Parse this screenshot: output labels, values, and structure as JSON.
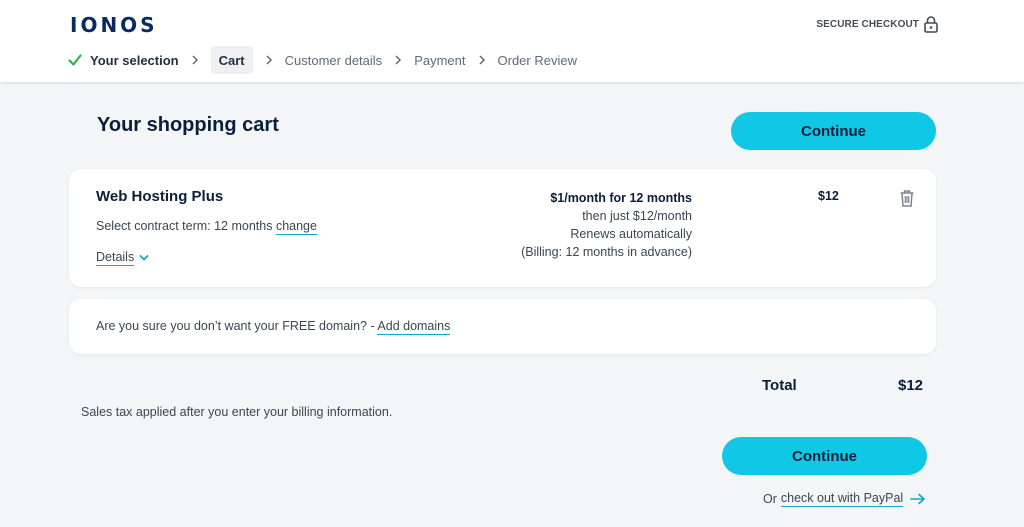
{
  "header": {
    "logo": "IONOS",
    "secure_checkout": "SECURE CHECKOUT",
    "steps": [
      {
        "label": "Your selection",
        "state": "done"
      },
      {
        "label": "Cart",
        "state": "active"
      },
      {
        "label": "Customer details",
        "state": "pending"
      },
      {
        "label": "Payment",
        "state": "pending"
      },
      {
        "label": "Order Review",
        "state": "pending"
      }
    ]
  },
  "cart": {
    "title": "Your shopping cart",
    "continue_label": "Continue",
    "item": {
      "name": "Web Hosting Plus",
      "term_text": "Select contract term: 12 months",
      "change_label": "change",
      "details_label": "Details",
      "pricing_lead": "$1/month for 12 months",
      "pricing_then": "then just $12/month",
      "pricing_renew": "Renews automatically",
      "pricing_billing": "(Billing: 12 months in advance)",
      "price": "$12"
    },
    "domain_prompt": "Are you sure you don’t want your FREE domain? -",
    "add_domains_label": "Add domains",
    "total_label": "Total",
    "total_value": "$12",
    "tax_note": "Sales tax applied after you enter your billing information.",
    "paypal_prefix": "Or",
    "paypal_link": "check out with PayPal"
  },
  "colors": {
    "accent": "#11c7e6",
    "brand": "#0b2a63",
    "check": "#2bb24c",
    "link_underline": "#11a7c6"
  },
  "icons": [
    "check-icon",
    "chevron-right-icon",
    "lock-icon",
    "chevron-down-icon",
    "trash-icon",
    "arrow-right-icon"
  ]
}
